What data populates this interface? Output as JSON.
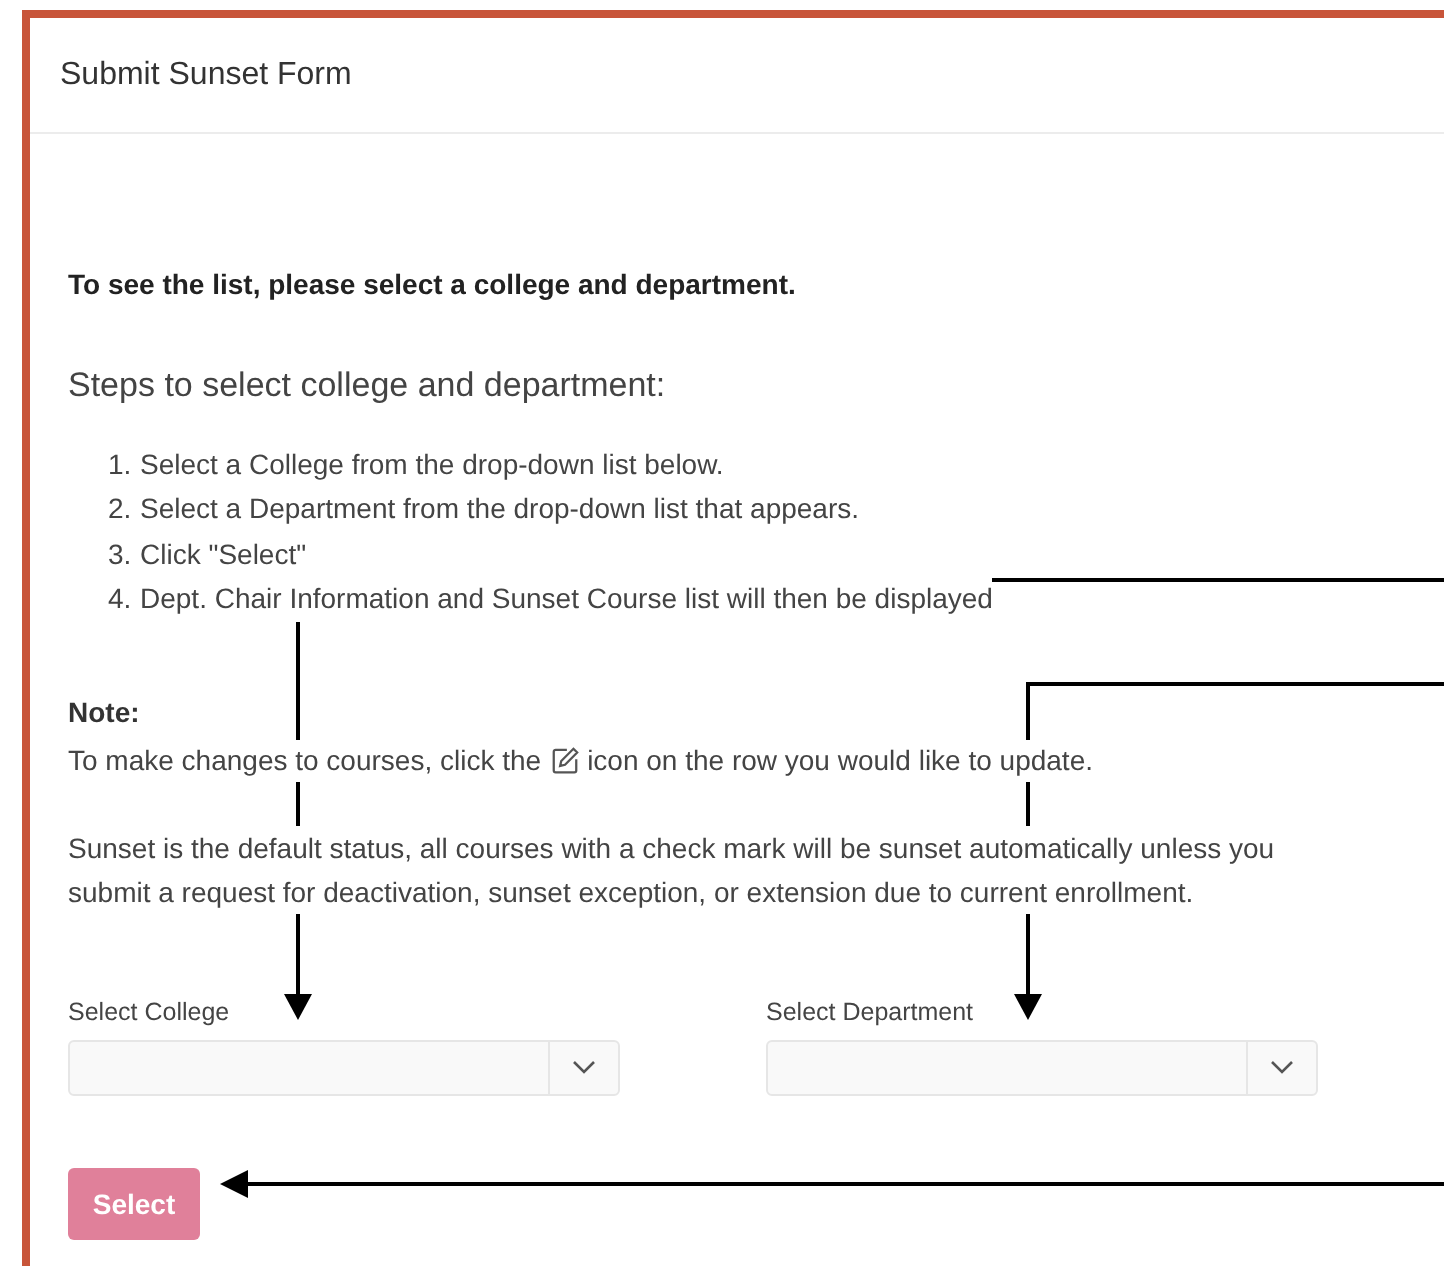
{
  "card": {
    "title": "Submit Sunset Form"
  },
  "intro": "To see the list, please select a college and department.",
  "steps_heading": "Steps to select college and department:",
  "steps": [
    {
      "number": "1.",
      "text": "Select a College from the drop-down list below."
    },
    {
      "number": "2.",
      "text": "Select a Department from the drop-down list that appears."
    },
    {
      "number": "3.",
      "text": "Click \"Select\""
    },
    {
      "number": "4.",
      "text": "Dept. Chair Information and Sunset Course list will then be displayed"
    }
  ],
  "note": {
    "heading": "Note:",
    "before_icon": "To make changes to courses, click the",
    "after_icon": "icon on the row you would like to update.",
    "status_text": "Sunset is the default status, all courses with a check mark will be sunset automatically unless you submit a request for deactivation, sunset exception, or extension due to current enrollment."
  },
  "dropdowns": [
    {
      "label": "Select College"
    },
    {
      "label": "Select Department"
    }
  ],
  "select_button": {
    "label": "Select",
    "disabled": true
  }
}
